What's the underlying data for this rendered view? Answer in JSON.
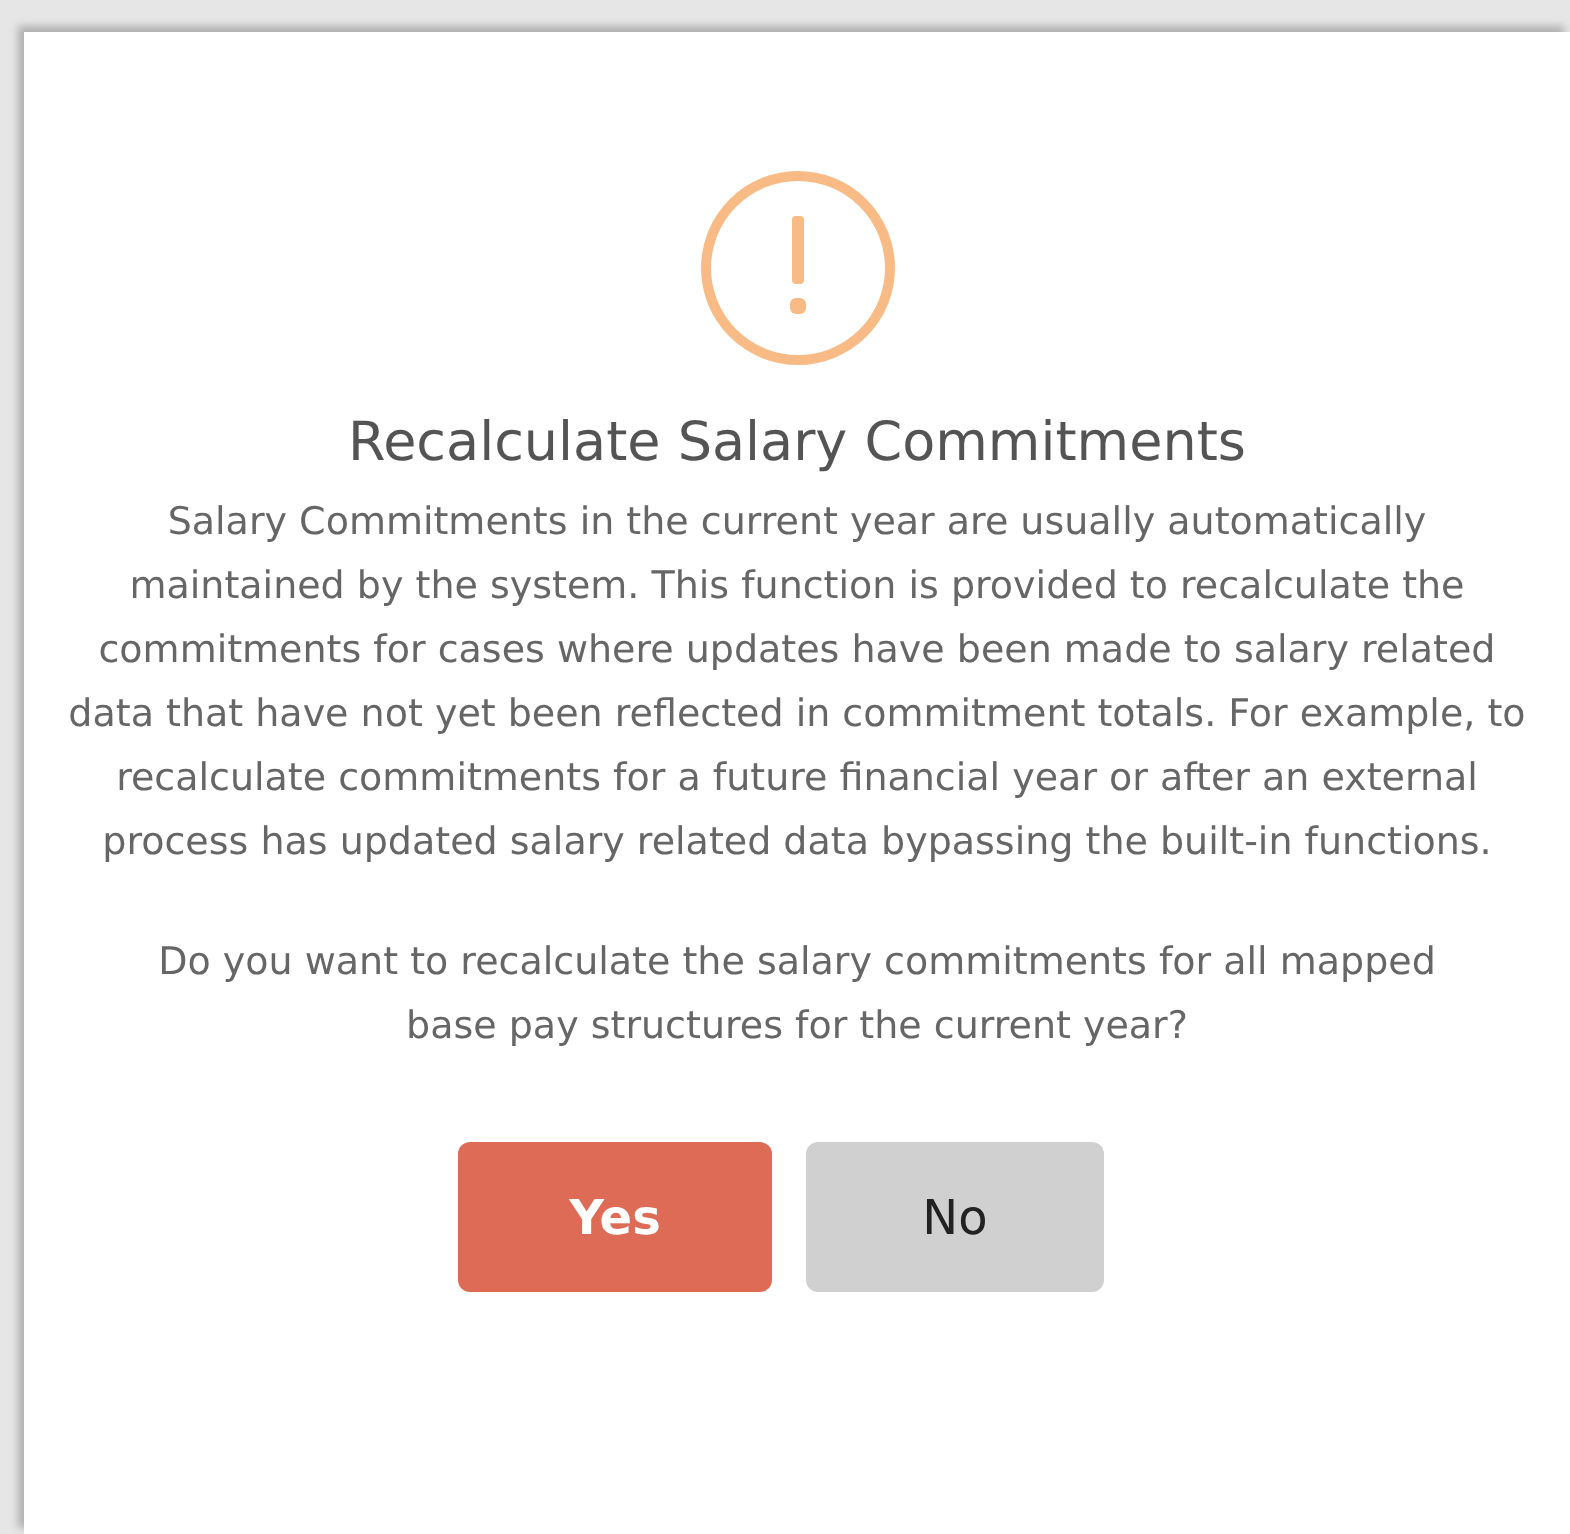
{
  "dialog": {
    "title": "Recalculate Salary Commitments",
    "message": "Salary Commitments in the current year are usually automatically maintained by the system. This function is provided to recalculate the commitments for cases where updates have been made to salary related data that have not yet been reflected in commitment totals. For example, to recalculate commitments for a future financial year or after an external process has updated salary related data bypassing the built-in functions.",
    "question": "Do you want to recalculate the salary commitments for all mapped base pay structures for the current year?",
    "buttons": [
      {
        "label": "Yes",
        "kind": "primary"
      },
      {
        "label": "No",
        "kind": "secondary"
      }
    ]
  }
}
